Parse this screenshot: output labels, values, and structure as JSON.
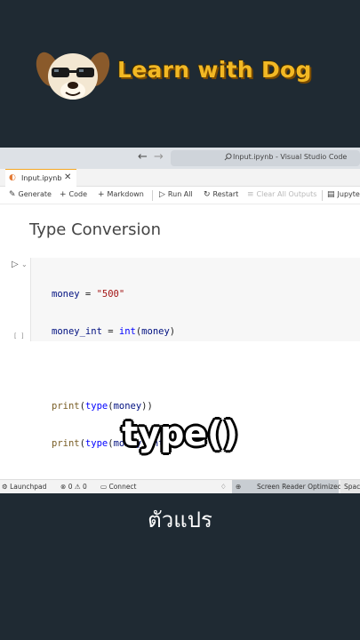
{
  "brand": {
    "title": "Learn with Dog"
  },
  "window": {
    "nav_back": "←",
    "nav_forward": "→",
    "title": "Input.ipynb - Visual Studio Code"
  },
  "tab": {
    "label": "Input.ipynb",
    "close": "✕"
  },
  "toolbar": {
    "generate": "Generate",
    "code": "Code",
    "markdown": "Markdown",
    "run_all": "Run All",
    "restart": "Restart",
    "clear_all_outputs": "Clear All Outputs",
    "jupyter": "Jupyte"
  },
  "notebook": {
    "heading": "Type Conversion",
    "exec_count": "[ ]",
    "code_lines": [
      "money = \"500\"",
      "money_int = int(money)",
      "",
      "print(type(money))",
      "print(type(money_int))"
    ]
  },
  "overlay": {
    "code_text": "type()"
  },
  "statusbar": {
    "launchpad": "Launchpad",
    "errors": "0",
    "warnings": "0",
    "connect": "Connect",
    "screen_reader": "Screen Reader Optimized",
    "spaces": "Spac"
  },
  "caption": "ตัวแปร",
  "colors": {
    "background": "#1f2a33",
    "brand_yellow": "#f2b824",
    "string": "#a31515",
    "function": "#795e26",
    "variable": "#001080"
  }
}
